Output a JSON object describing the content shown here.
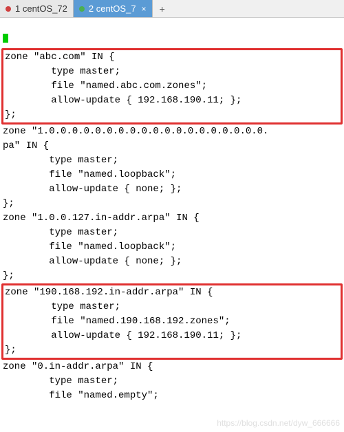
{
  "tabs": [
    {
      "label": "1 centOS_72",
      "active": false,
      "dot": "red"
    },
    {
      "label": "2 centOS_7",
      "active": true,
      "dot": "green"
    }
  ],
  "tab_close": "×",
  "tab_add": "+",
  "zones": [
    {
      "highlighted": true,
      "header": "zone \"abc.com\" IN {",
      "lines": [
        "        type master;",
        "        file \"named.abc.com.zones\";",
        "        allow-update { 192.168.190.11; };"
      ],
      "footer": "};"
    },
    {
      "highlighted": false,
      "header": "zone \"1.0.0.0.0.0.0.0.0.0.0.0.0.0.0.0.0.0.0.0.",
      "header2": "pa\" IN {",
      "lines": [
        "        type master;",
        "        file \"named.loopback\";",
        "        allow-update { none; };"
      ],
      "footer": "};"
    },
    {
      "highlighted": false,
      "header": "zone \"1.0.0.127.in-addr.arpa\" IN {",
      "lines": [
        "        type master;",
        "        file \"named.loopback\";",
        "        allow-update { none; };"
      ],
      "footer": "};"
    },
    {
      "highlighted": true,
      "header": "zone \"190.168.192.in-addr.arpa\" IN {",
      "lines": [
        "        type master;",
        "        file \"named.190.168.192.zones\";",
        "        allow-update { 192.168.190.11; };"
      ],
      "footer": "};"
    },
    {
      "highlighted": false,
      "header": "zone \"0.in-addr.arpa\" IN {",
      "lines": [
        "        type master;",
        "        file \"named.empty\";"
      ]
    }
  ],
  "watermark": "https://blog.csdn.net/dyw_666666"
}
